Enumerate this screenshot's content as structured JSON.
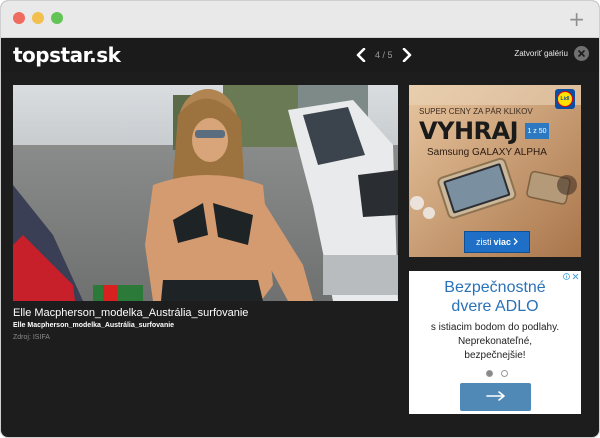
{
  "browser": {
    "new_tab_label": "+"
  },
  "header": {
    "logo": "topstar.sk",
    "counter": "4 / 5",
    "close_label": "Zatvoriť galériu"
  },
  "photo": {
    "title": "Elle Macpherson_modelka_Austrália_surfovanie",
    "subtitle": "Elle Macpherson_modelka_Austrália_surfovanie",
    "source": "Zdroj: ISIFA"
  },
  "ad_lidl": {
    "headline": "SUPER CENY ZA PÁR KLIKOV",
    "big_text": "VYHRAJ",
    "badge": "1 z 50",
    "product": "Samsung GALAXY ALPHA",
    "button_prefix": "zisti",
    "button_bold": "viac",
    "brand": "Lidl"
  },
  "ad_adlo": {
    "title_line1": "Bezpečnostné",
    "title_line2": "dvere ADLO",
    "body_line1": "s istiacim bodom do podlahy.",
    "body_line2": "Neprekonateľné,",
    "body_line3": "bezpečnejšie!"
  },
  "colors": {
    "accent_blue": "#2a72b8",
    "button_blue": "#5189b6",
    "lidl_blue": "#0a4ea3",
    "lidl_yellow": "#ffe000"
  }
}
